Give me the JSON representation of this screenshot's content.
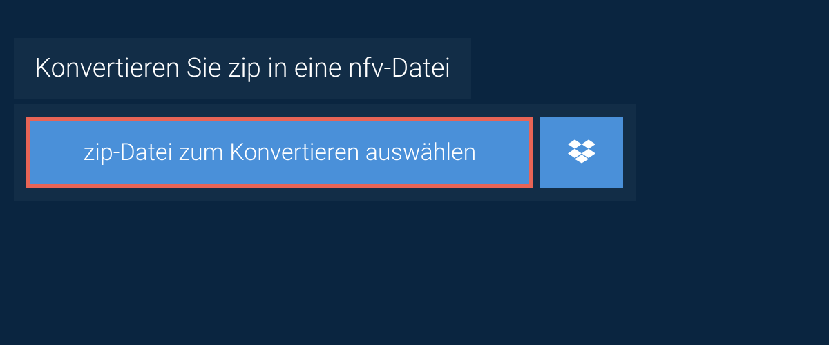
{
  "header": {
    "title": "Konvertieren Sie zip in eine nfv-Datei"
  },
  "upload": {
    "select_button_label": "zip-Datei zum Konvertieren auswählen",
    "dropbox_icon_name": "dropbox-icon"
  },
  "colors": {
    "background": "#0a2540",
    "panel": "#122d47",
    "button": "#4a90d9",
    "highlight_border": "#e86456",
    "text": "#ffffff"
  }
}
